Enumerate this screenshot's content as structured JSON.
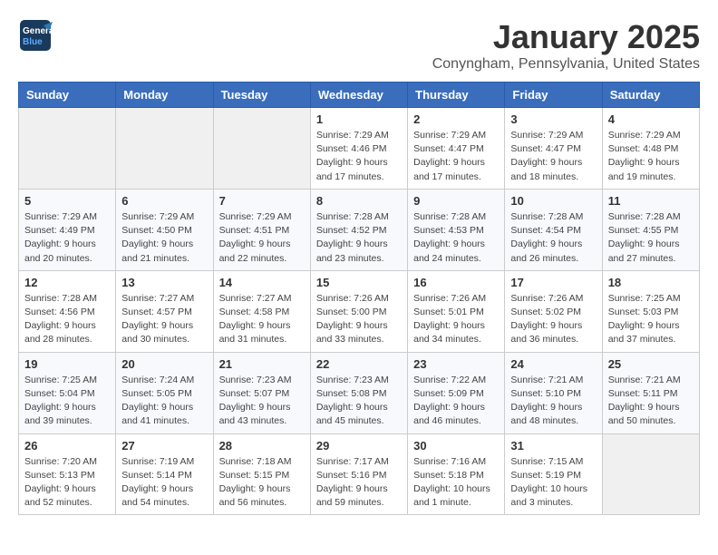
{
  "logo": {
    "line1": "General",
    "line2": "Blue"
  },
  "title": "January 2025",
  "subtitle": "Conyngham, Pennsylvania, United States",
  "weekdays": [
    "Sunday",
    "Monday",
    "Tuesday",
    "Wednesday",
    "Thursday",
    "Friday",
    "Saturday"
  ],
  "weeks": [
    [
      {
        "day": "",
        "info": ""
      },
      {
        "day": "",
        "info": ""
      },
      {
        "day": "",
        "info": ""
      },
      {
        "day": "1",
        "info": "Sunrise: 7:29 AM\nSunset: 4:46 PM\nDaylight: 9 hours\nand 17 minutes."
      },
      {
        "day": "2",
        "info": "Sunrise: 7:29 AM\nSunset: 4:47 PM\nDaylight: 9 hours\nand 17 minutes."
      },
      {
        "day": "3",
        "info": "Sunrise: 7:29 AM\nSunset: 4:47 PM\nDaylight: 9 hours\nand 18 minutes."
      },
      {
        "day": "4",
        "info": "Sunrise: 7:29 AM\nSunset: 4:48 PM\nDaylight: 9 hours\nand 19 minutes."
      }
    ],
    [
      {
        "day": "5",
        "info": "Sunrise: 7:29 AM\nSunset: 4:49 PM\nDaylight: 9 hours\nand 20 minutes."
      },
      {
        "day": "6",
        "info": "Sunrise: 7:29 AM\nSunset: 4:50 PM\nDaylight: 9 hours\nand 21 minutes."
      },
      {
        "day": "7",
        "info": "Sunrise: 7:29 AM\nSunset: 4:51 PM\nDaylight: 9 hours\nand 22 minutes."
      },
      {
        "day": "8",
        "info": "Sunrise: 7:28 AM\nSunset: 4:52 PM\nDaylight: 9 hours\nand 23 minutes."
      },
      {
        "day": "9",
        "info": "Sunrise: 7:28 AM\nSunset: 4:53 PM\nDaylight: 9 hours\nand 24 minutes."
      },
      {
        "day": "10",
        "info": "Sunrise: 7:28 AM\nSunset: 4:54 PM\nDaylight: 9 hours\nand 26 minutes."
      },
      {
        "day": "11",
        "info": "Sunrise: 7:28 AM\nSunset: 4:55 PM\nDaylight: 9 hours\nand 27 minutes."
      }
    ],
    [
      {
        "day": "12",
        "info": "Sunrise: 7:28 AM\nSunset: 4:56 PM\nDaylight: 9 hours\nand 28 minutes."
      },
      {
        "day": "13",
        "info": "Sunrise: 7:27 AM\nSunset: 4:57 PM\nDaylight: 9 hours\nand 30 minutes."
      },
      {
        "day": "14",
        "info": "Sunrise: 7:27 AM\nSunset: 4:58 PM\nDaylight: 9 hours\nand 31 minutes."
      },
      {
        "day": "15",
        "info": "Sunrise: 7:26 AM\nSunset: 5:00 PM\nDaylight: 9 hours\nand 33 minutes."
      },
      {
        "day": "16",
        "info": "Sunrise: 7:26 AM\nSunset: 5:01 PM\nDaylight: 9 hours\nand 34 minutes."
      },
      {
        "day": "17",
        "info": "Sunrise: 7:26 AM\nSunset: 5:02 PM\nDaylight: 9 hours\nand 36 minutes."
      },
      {
        "day": "18",
        "info": "Sunrise: 7:25 AM\nSunset: 5:03 PM\nDaylight: 9 hours\nand 37 minutes."
      }
    ],
    [
      {
        "day": "19",
        "info": "Sunrise: 7:25 AM\nSunset: 5:04 PM\nDaylight: 9 hours\nand 39 minutes."
      },
      {
        "day": "20",
        "info": "Sunrise: 7:24 AM\nSunset: 5:05 PM\nDaylight: 9 hours\nand 41 minutes."
      },
      {
        "day": "21",
        "info": "Sunrise: 7:23 AM\nSunset: 5:07 PM\nDaylight: 9 hours\nand 43 minutes."
      },
      {
        "day": "22",
        "info": "Sunrise: 7:23 AM\nSunset: 5:08 PM\nDaylight: 9 hours\nand 45 minutes."
      },
      {
        "day": "23",
        "info": "Sunrise: 7:22 AM\nSunset: 5:09 PM\nDaylight: 9 hours\nand 46 minutes."
      },
      {
        "day": "24",
        "info": "Sunrise: 7:21 AM\nSunset: 5:10 PM\nDaylight: 9 hours\nand 48 minutes."
      },
      {
        "day": "25",
        "info": "Sunrise: 7:21 AM\nSunset: 5:11 PM\nDaylight: 9 hours\nand 50 minutes."
      }
    ],
    [
      {
        "day": "26",
        "info": "Sunrise: 7:20 AM\nSunset: 5:13 PM\nDaylight: 9 hours\nand 52 minutes."
      },
      {
        "day": "27",
        "info": "Sunrise: 7:19 AM\nSunset: 5:14 PM\nDaylight: 9 hours\nand 54 minutes."
      },
      {
        "day": "28",
        "info": "Sunrise: 7:18 AM\nSunset: 5:15 PM\nDaylight: 9 hours\nand 56 minutes."
      },
      {
        "day": "29",
        "info": "Sunrise: 7:17 AM\nSunset: 5:16 PM\nDaylight: 9 hours\nand 59 minutes."
      },
      {
        "day": "30",
        "info": "Sunrise: 7:16 AM\nSunset: 5:18 PM\nDaylight: 10 hours\nand 1 minute."
      },
      {
        "day": "31",
        "info": "Sunrise: 7:15 AM\nSunset: 5:19 PM\nDaylight: 10 hours\nand 3 minutes."
      },
      {
        "day": "",
        "info": ""
      }
    ]
  ]
}
